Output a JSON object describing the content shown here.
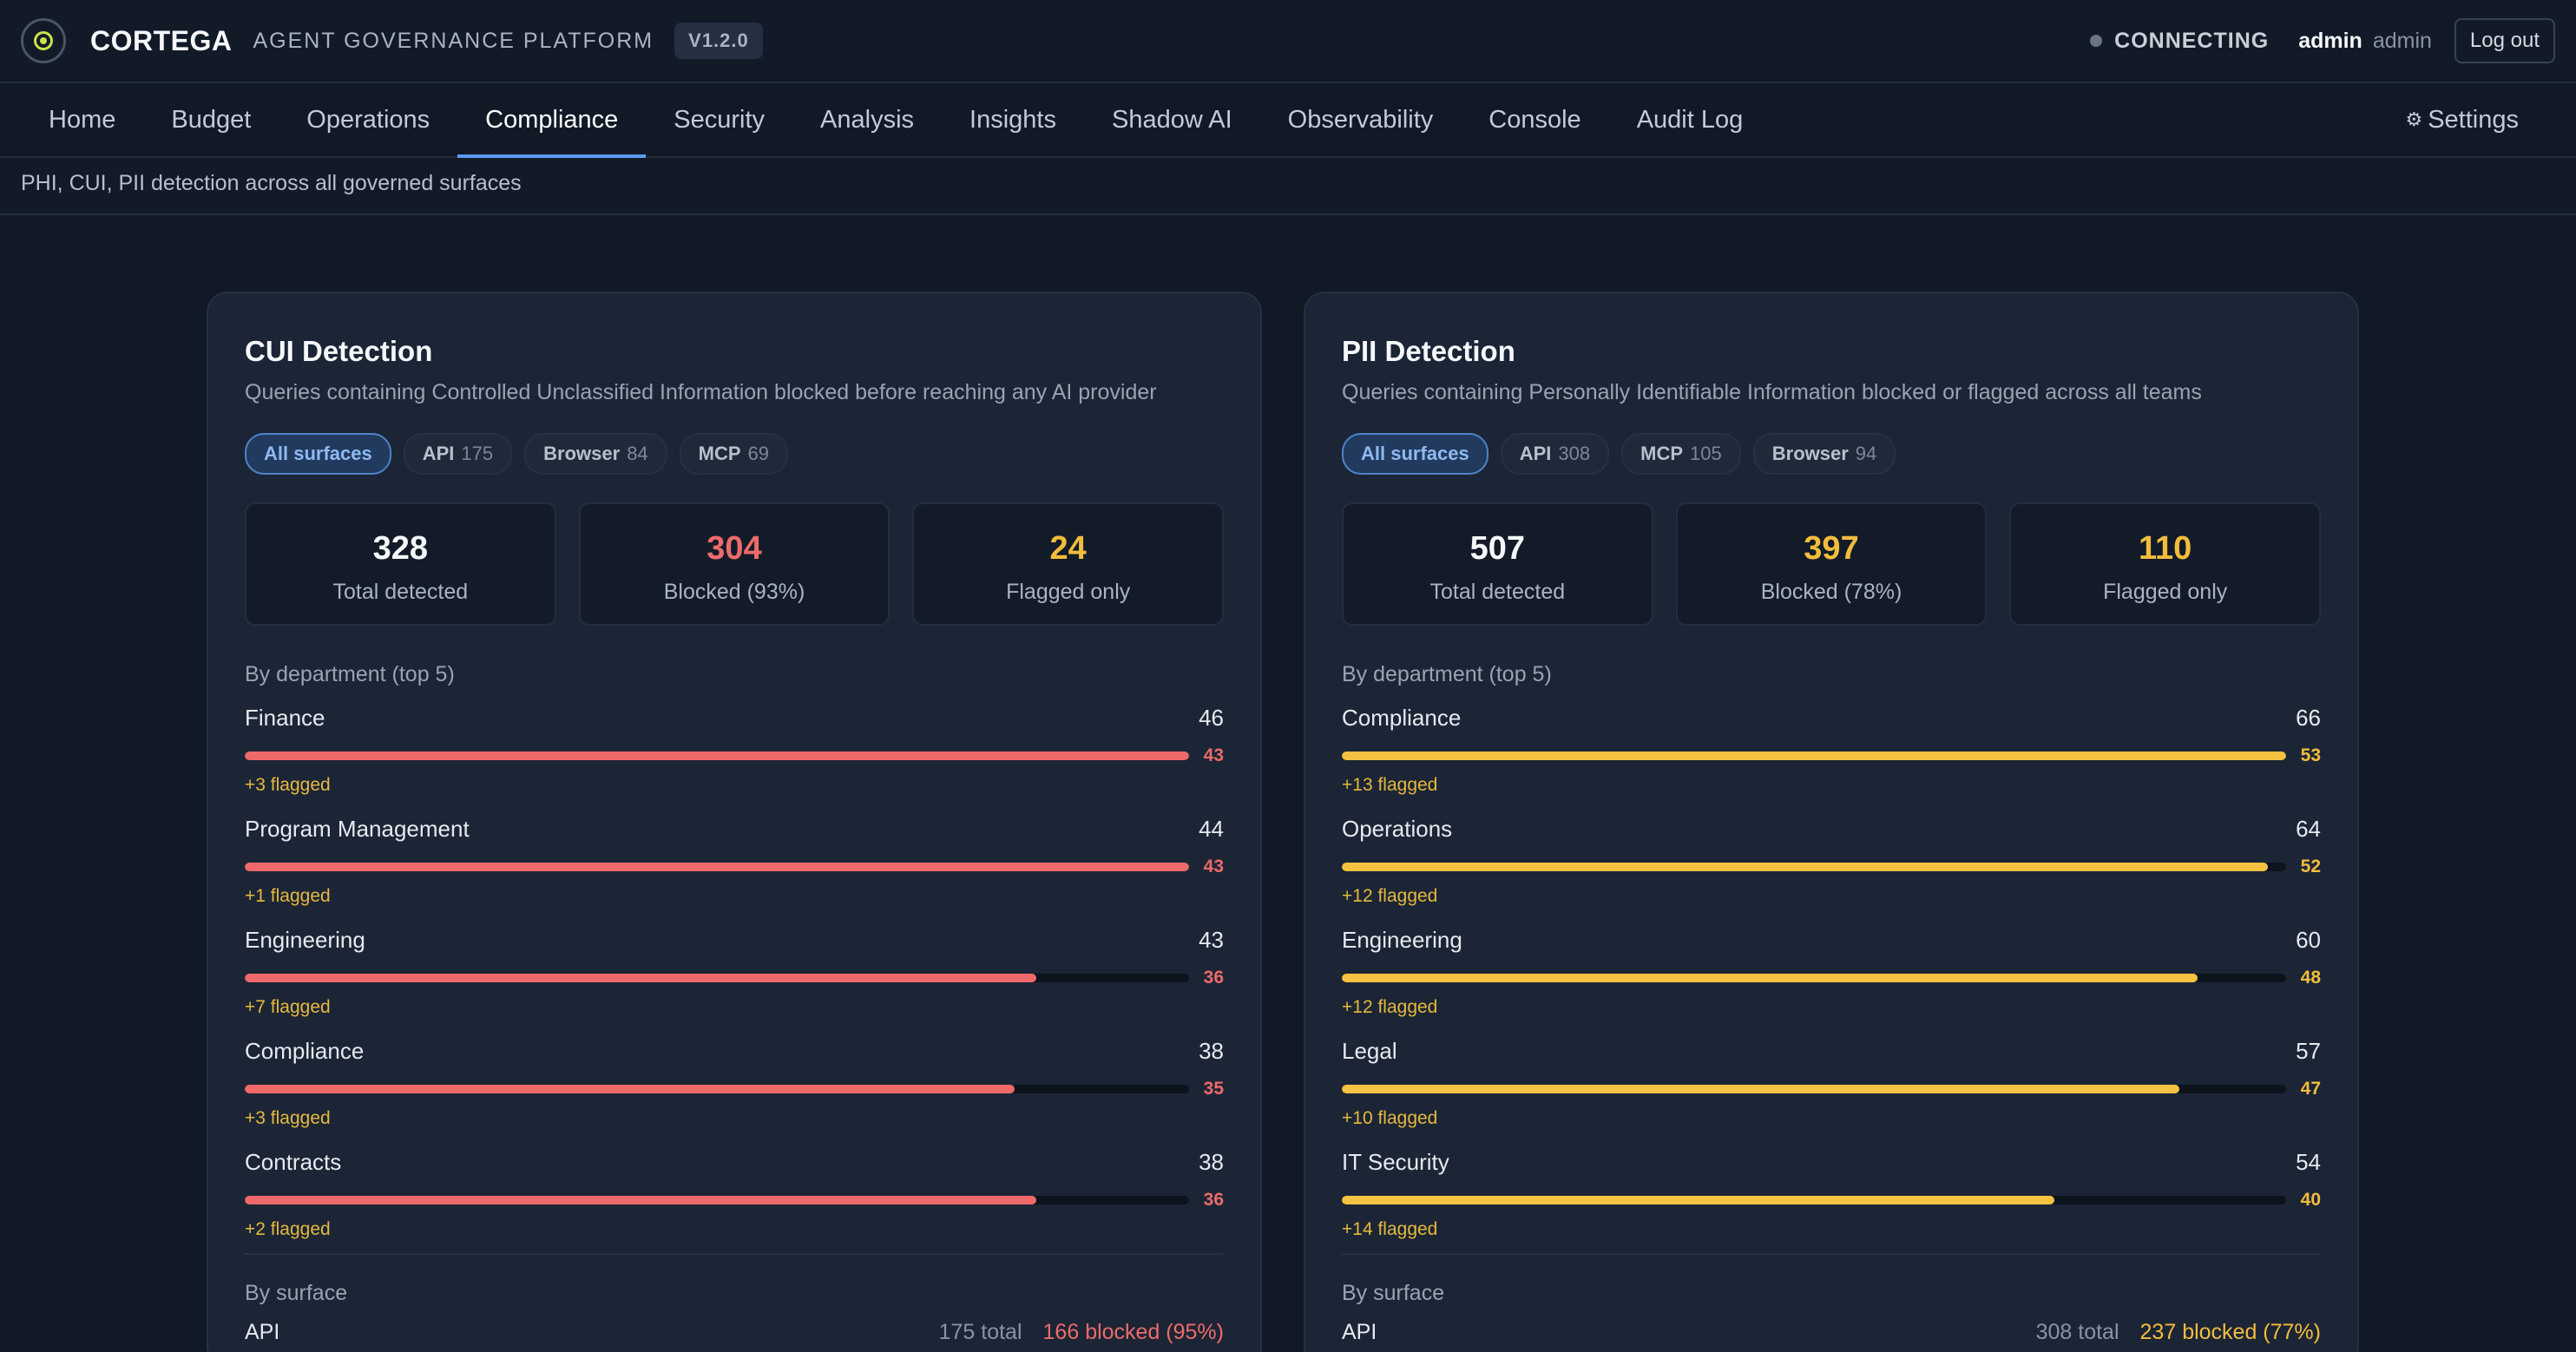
{
  "header": {
    "brand": "CORTEGA",
    "platform": "AGENT GOVERNANCE PLATFORM",
    "version": "V1.2.0",
    "connection_status": "CONNECTING",
    "user_name": "admin",
    "user_role": "admin",
    "logout_label": "Log out",
    "logo_icon": "cortega-logo-icon"
  },
  "nav": {
    "items": [
      "Home",
      "Budget",
      "Operations",
      "Compliance",
      "Security",
      "Analysis",
      "Insights",
      "Shadow AI",
      "Observability",
      "Console",
      "Audit Log"
    ],
    "active": "Compliance",
    "settings_label": "Settings",
    "settings_icon": "gear-icon"
  },
  "subtitle": "PHI, CUI, PII detection across all governed surfaces",
  "colors": {
    "cui_accent": "#ec6b6b",
    "pii_accent": "#f2bd3c",
    "active_chip": "#4e83c9"
  },
  "cui": {
    "title": "CUI Detection",
    "description": "Queries containing Controlled Unclassified Information blocked before reaching any AI provider",
    "chips": [
      {
        "label": "All surfaces",
        "count": ""
      },
      {
        "label": "API",
        "count": "175"
      },
      {
        "label": "Browser",
        "count": "84"
      },
      {
        "label": "MCP",
        "count": "69"
      }
    ],
    "stats": {
      "total_value": "328",
      "total_label": "Total detected",
      "blocked_value": "304",
      "blocked_label": "Blocked (93%)",
      "flagged_value": "24",
      "flagged_label": "Flagged only"
    },
    "dept_label": "By department (top 5)",
    "departments": [
      {
        "name": "Finance",
        "total": "46",
        "blocked": "43",
        "flagged": "+3 flagged",
        "fill": 1.0
      },
      {
        "name": "Program Management",
        "total": "44",
        "blocked": "43",
        "flagged": "+1 flagged",
        "fill": 1.0
      },
      {
        "name": "Engineering",
        "total": "43",
        "blocked": "36",
        "flagged": "+7 flagged",
        "fill": 0.838
      },
      {
        "name": "Compliance",
        "total": "38",
        "blocked": "35",
        "flagged": "+3 flagged",
        "fill": 0.815
      },
      {
        "name": "Contracts",
        "total": "38",
        "blocked": "36",
        "flagged": "+2 flagged",
        "fill": 0.838
      }
    ],
    "surface_label": "By surface",
    "surface": {
      "name": "API",
      "total": "175 total",
      "blocked": "166 blocked (95%)"
    }
  },
  "pii": {
    "title": "PII Detection",
    "description": "Queries containing Personally Identifiable Information blocked or flagged across all teams",
    "chips": [
      {
        "label": "All surfaces",
        "count": ""
      },
      {
        "label": "API",
        "count": "308"
      },
      {
        "label": "MCP",
        "count": "105"
      },
      {
        "label": "Browser",
        "count": "94"
      }
    ],
    "stats": {
      "total_value": "507",
      "total_label": "Total detected",
      "blocked_value": "397",
      "blocked_label": "Blocked (78%)",
      "flagged_value": "110",
      "flagged_label": "Flagged only"
    },
    "dept_label": "By department (top 5)",
    "departments": [
      {
        "name": "Compliance",
        "total": "66",
        "blocked": "53",
        "flagged": "+13 flagged",
        "fill": 1.0
      },
      {
        "name": "Operations",
        "total": "64",
        "blocked": "52",
        "flagged": "+12 flagged",
        "fill": 0.981
      },
      {
        "name": "Engineering",
        "total": "60",
        "blocked": "48",
        "flagged": "+12 flagged",
        "fill": 0.906
      },
      {
        "name": "Legal",
        "total": "57",
        "blocked": "47",
        "flagged": "+10 flagged",
        "fill": 0.887
      },
      {
        "name": "IT Security",
        "total": "54",
        "blocked": "40",
        "flagged": "+14 flagged",
        "fill": 0.755
      }
    ],
    "surface_label": "By surface",
    "surface": {
      "name": "API",
      "total": "308 total",
      "blocked": "237 blocked (77%)"
    }
  }
}
